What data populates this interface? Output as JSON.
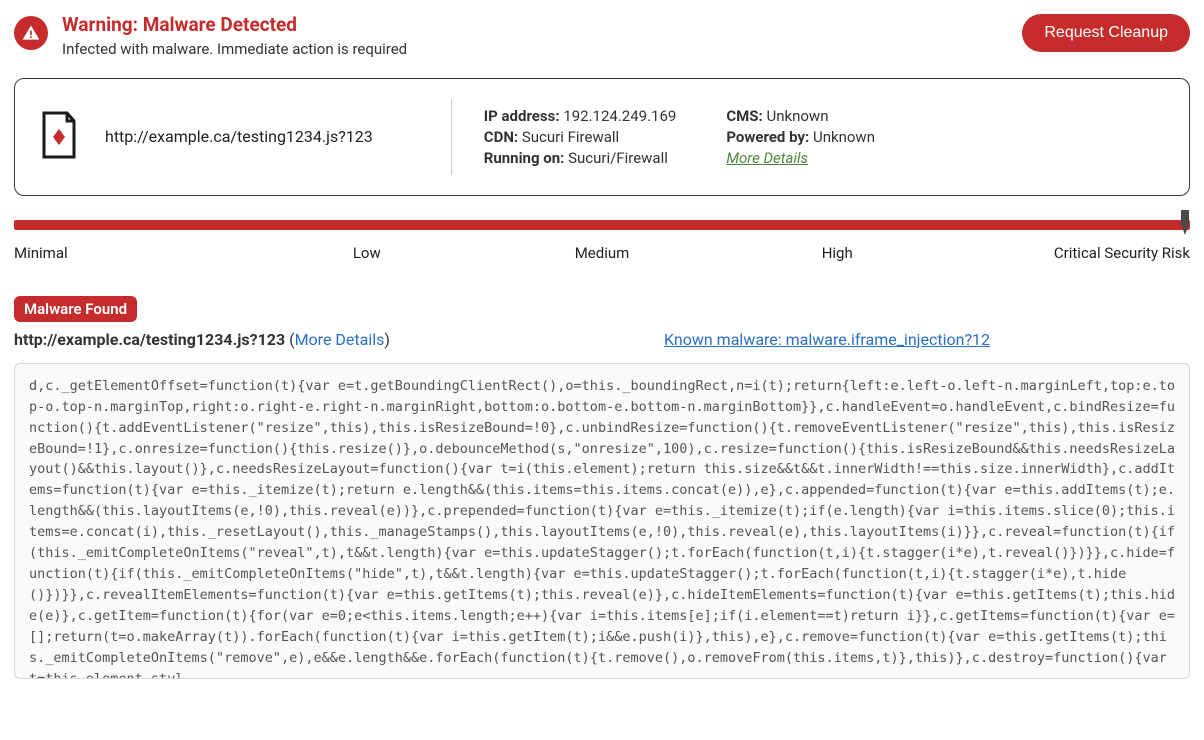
{
  "header": {
    "title": "Warning: Malware Detected",
    "subtitle": "Infected with malware. Immediate action is required",
    "cleanup_button": "Request Cleanup"
  },
  "summary": {
    "url": "http://example.ca/testing1234.js?123",
    "meta_left": {
      "ip_label": "IP address:",
      "ip_value": "192.124.249.169",
      "cdn_label": "CDN:",
      "cdn_value": "Sucuri Firewall",
      "running_label": "Running on:",
      "running_value": "Sucuri/Firewall"
    },
    "meta_right": {
      "cms_label": "CMS:",
      "cms_value": "Unknown",
      "powered_label": "Powered by:",
      "powered_value": "Unknown",
      "more_details": "More Details"
    }
  },
  "risk": {
    "labels": [
      "Minimal",
      "Low",
      "Medium",
      "High",
      "Critical Security Risk"
    ]
  },
  "result": {
    "badge": "Malware Found",
    "url": "http://example.ca/testing1234.js?123",
    "more_details": "More Details",
    "known_malware": "Known malware: malware.iframe_injection?12"
  },
  "code": "d,c._getElementOffset=function(t){var e=t.getBoundingClientRect(),o=this._boundingRect,n=i(t);return{left:e.left-o.left-n.marginLeft,top:e.top-o.top-n.marginTop,right:o.right-e.right-n.marginRight,bottom:o.bottom-e.bottom-n.marginBottom}},c.handleEvent=o.handleEvent,c.bindResize=function(){t.addEventListener(\"resize\",this),this.isResizeBound=!0},c.unbindResize=function(){t.removeEventListener(\"resize\",this),this.isResizeBound=!1},c.onresize=function(){this.resize()},o.debounceMethod(s,\"onresize\",100),c.resize=function(){this.isResizeBound&&this.needsResizeLayout()&&this.layout()},c.needsResizeLayout=function(){var t=i(this.element);return this.size&&t&&t.innerWidth!==this.size.innerWidth},c.addItems=function(t){var e=this._itemize(t);return e.length&&(this.items=this.items.concat(e)),e},c.appended=function(t){var e=this.addItems(t);e.length&&(this.layoutItems(e,!0),this.reveal(e))},c.prepended=function(t){var e=this._itemize(t);if(e.length){var i=this.items.slice(0);this.items=e.concat(i),this._resetLayout(),this._manageStamps(),this.layoutItems(e,!0),this.reveal(e),this.layoutItems(i)}},c.reveal=function(t){if(this._emitCompleteOnItems(\"reveal\",t),t&&t.length){var e=this.updateStagger();t.forEach(function(t,i){t.stagger(i*e),t.reveal()})}},c.hide=function(t){if(this._emitCompleteOnItems(\"hide\",t),t&&t.length){var e=this.updateStagger();t.forEach(function(t,i){t.stagger(i*e),t.hide()})}},c.revealItemElements=function(t){var e=this.getItems(t);this.reveal(e)},c.hideItemElements=function(t){var e=this.getItems(t);this.hide(e)},c.getItem=function(t){for(var e=0;e<this.items.length;e++){var i=this.items[e];if(i.element==t)return i}},c.getItems=function(t){var e=[];return(t=o.makeArray(t)).forEach(function(t){var i=this.getItem(t);i&&e.push(i)},this),e},c.remove=function(t){var e=this.getItems(t);this._emitCompleteOnItems(\"remove\",e),e&&e.length&&e.forEach(function(t){t.remove(),o.removeFrom(this.items,t)},this)},c.destroy=function(){var t=this.element.styl"
}
